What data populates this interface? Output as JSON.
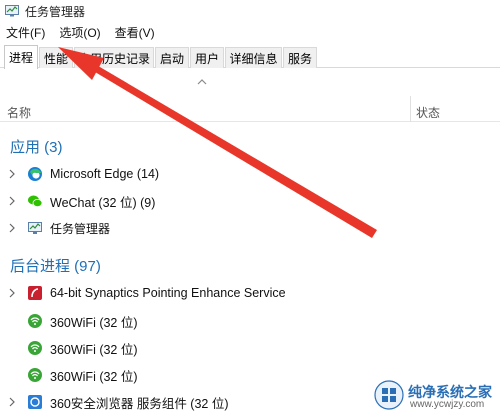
{
  "window": {
    "title": "任务管理器"
  },
  "menu": [
    "文件(F)",
    "选项(O)",
    "查看(V)"
  ],
  "tabs": [
    {
      "label": "进程",
      "active": true
    },
    {
      "label": "性能",
      "active": false
    },
    {
      "label": "应用历史记录",
      "active": false
    },
    {
      "label": "启动",
      "active": false
    },
    {
      "label": "用户",
      "active": false
    },
    {
      "label": "详细信息",
      "active": false
    },
    {
      "label": "服务",
      "active": false
    }
  ],
  "columns": {
    "name": "名称",
    "status": "状态"
  },
  "groups": {
    "apps": {
      "title": "应用 (3)",
      "items": [
        {
          "label": "Microsoft Edge (14)",
          "icon": "edge-icon"
        },
        {
          "label": "WeChat (32 位) (9)",
          "icon": "wechat-icon"
        },
        {
          "label": "任务管理器",
          "icon": "task-manager-icon"
        }
      ]
    },
    "background": {
      "title": "后台进程 (97)",
      "items": [
        {
          "label": "64-bit Synaptics Pointing Enhance Service",
          "icon": "synaptics-icon"
        },
        {
          "label": "360WiFi (32 位)",
          "icon": "wifi-360-icon"
        },
        {
          "label": "360WiFi (32 位)",
          "icon": "wifi-360-icon"
        },
        {
          "label": "360WiFi (32 位)",
          "icon": "wifi-360-icon"
        },
        {
          "label": "360安全浏览器 服务组件 (32 位)",
          "icon": "browser-360-icon"
        }
      ]
    }
  },
  "watermark": {
    "title": "纯净系统之家",
    "url": "www.ycwjzy.com"
  },
  "colors": {
    "accent": "#1f6fb5",
    "arrow": "#e8372a"
  }
}
